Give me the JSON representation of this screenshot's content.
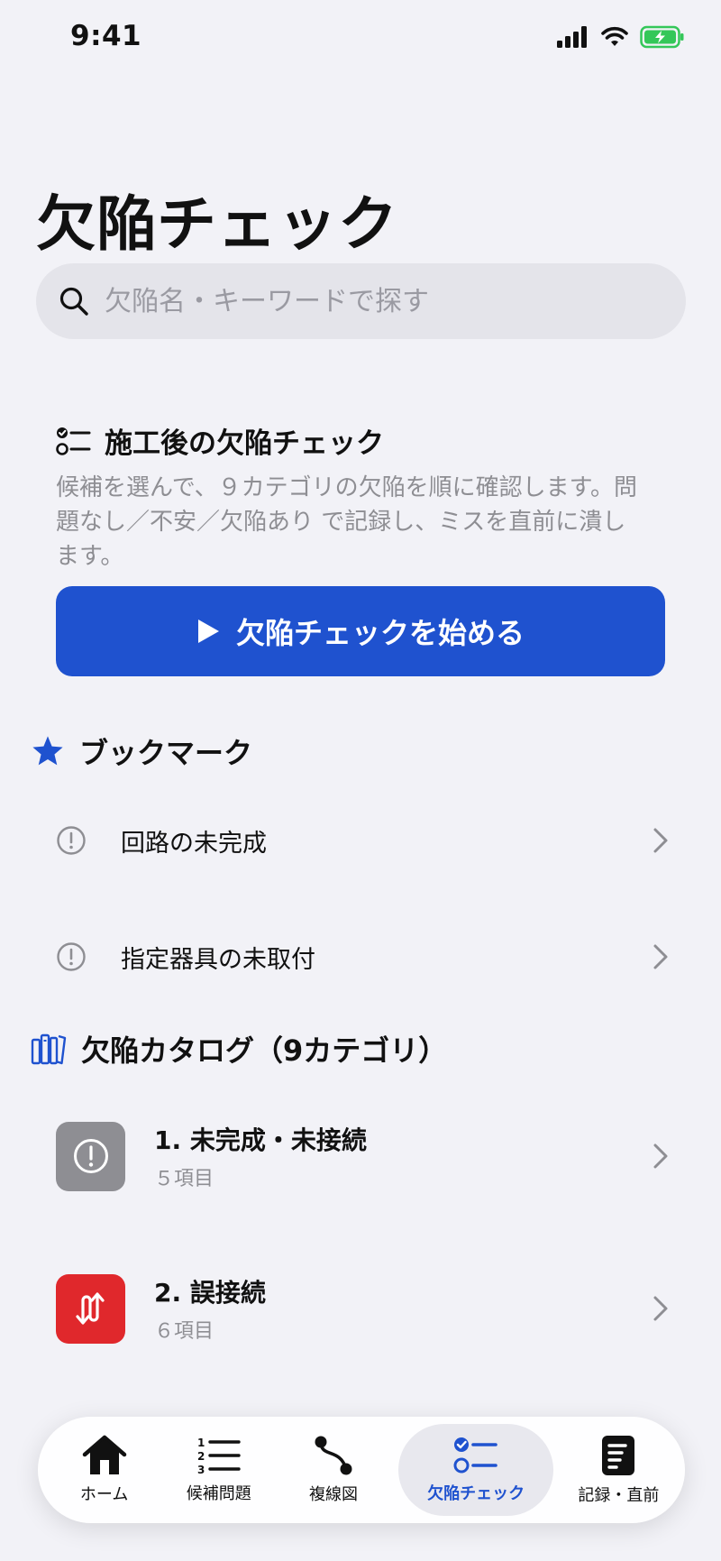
{
  "status": {
    "time": "9:41"
  },
  "page_title": "欠陥チェック",
  "search": {
    "placeholder": "欠陥名・キーワードで探す",
    "value": ""
  },
  "intro": {
    "title": "施工後の欠陥チェック",
    "description": "候補を選んで、９カテゴリの欠陥を順に確認します。問題なし／不安／欠陥あり で記録し、ミスを直前に潰します。",
    "start_button": "欠陥チェックを始める"
  },
  "bookmarks": {
    "title": "ブックマーク",
    "items": [
      {
        "label": "回路の未完成"
      },
      {
        "label": "指定器具の未取付"
      }
    ]
  },
  "catalog": {
    "title": "欠陥カタログ（9カテゴリ）",
    "items": [
      {
        "name": "1. 未完成・未接続",
        "count": "５項目",
        "color": "#8e8e93",
        "icon": "exclamation-circle-icon"
      },
      {
        "name": "2. 誤接続",
        "count": "６項目",
        "color": "#e0282c",
        "icon": "swap-arrows-icon"
      }
    ]
  },
  "tabs": [
    {
      "label": "ホーム",
      "icon": "house-icon",
      "active": false
    },
    {
      "label": "候補問題",
      "icon": "numbered-list-icon",
      "active": false
    },
    {
      "label": "複線図",
      "icon": "route-icon",
      "active": false
    },
    {
      "label": "欠陥チェック",
      "icon": "checklist-icon",
      "active": true
    },
    {
      "label": "記録・直前",
      "icon": "document-icon",
      "active": false
    }
  ],
  "colors": {
    "accent": "#1f52cf",
    "background": "#f2f2f7",
    "secondary_text": "#8e8e93"
  }
}
